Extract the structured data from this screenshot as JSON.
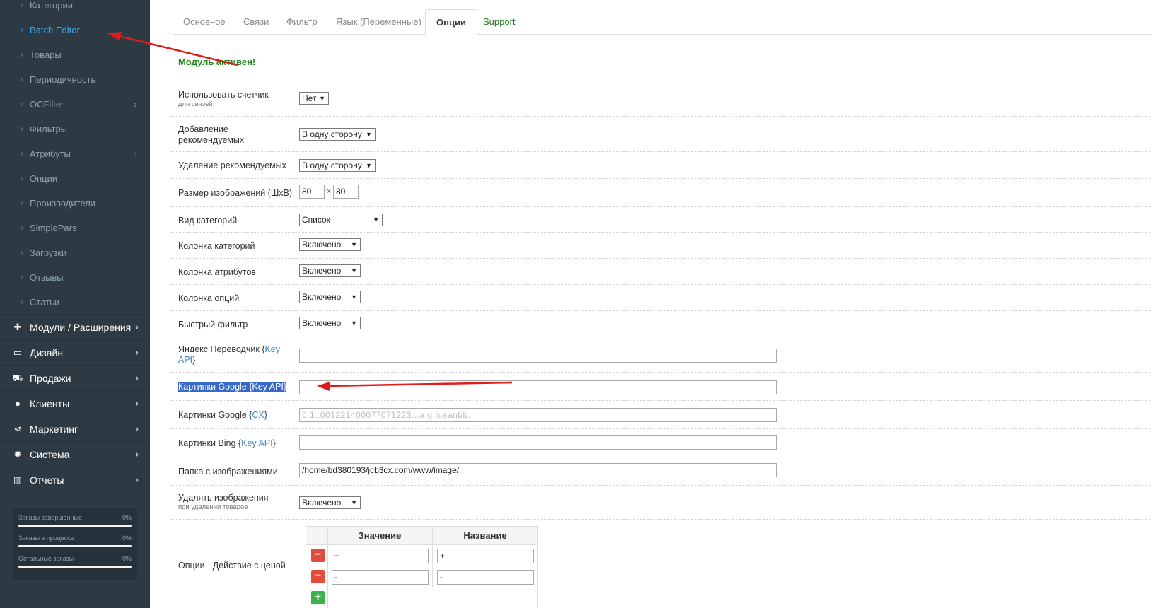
{
  "sidebar": {
    "sub_items": [
      {
        "label": "Категории",
        "has_arrow": false,
        "active": false
      },
      {
        "label": "Batch Editor",
        "has_arrow": false,
        "active": true
      },
      {
        "label": "Товары",
        "has_arrow": false,
        "active": false
      },
      {
        "label": "Периодичность",
        "has_arrow": false,
        "active": false
      },
      {
        "label": "OCFilter",
        "has_arrow": true,
        "active": false
      },
      {
        "label": "Фильтры",
        "has_arrow": false,
        "active": false
      },
      {
        "label": "Атрибуты",
        "has_arrow": true,
        "active": false
      },
      {
        "label": "Опции",
        "has_arrow": false,
        "active": false
      },
      {
        "label": "Производители",
        "has_arrow": false,
        "active": false
      },
      {
        "label": "SimplePars",
        "has_arrow": false,
        "active": false
      },
      {
        "label": "Загрузки",
        "has_arrow": false,
        "active": false
      },
      {
        "label": "Отзывы",
        "has_arrow": false,
        "active": false
      },
      {
        "label": "Статьи",
        "has_arrow": false,
        "active": false
      }
    ],
    "main_items": [
      {
        "label": "Модули / Расширения",
        "icon": "puzzle-icon"
      },
      {
        "label": "Дизайн",
        "icon": "monitor-icon"
      },
      {
        "label": "Продажи",
        "icon": "cart-icon"
      },
      {
        "label": "Клиенты",
        "icon": "user-icon"
      },
      {
        "label": "Маркетинг",
        "icon": "share-icon"
      },
      {
        "label": "Система",
        "icon": "gear-icon"
      },
      {
        "label": "Отчеты",
        "icon": "bar-chart-icon"
      }
    ],
    "stats": [
      {
        "label": "Заказы завершенные",
        "value": "0%",
        "progress": 0
      },
      {
        "label": "Заказы в процессе",
        "value": "0%",
        "progress": 0
      },
      {
        "label": "Остальные заказы",
        "value": "0%",
        "progress": 0
      }
    ]
  },
  "tabs": [
    "Основное",
    "Связи",
    "Фильтр",
    "Язык (Переменные)",
    "Опции",
    "Support"
  ],
  "active_tab": "Опции",
  "status": "Модуль активен!",
  "form": {
    "counter": {
      "label": "Использовать счетчик",
      "hint": "для связей",
      "value": "Нет"
    },
    "add_recommended": {
      "label": "Добавление рекомендуемых",
      "value": "В одну сторону"
    },
    "remove_recommended": {
      "label": "Удаление рекомендуемых",
      "value": "В одну сторону"
    },
    "image_size": {
      "label": "Размер изображений (ШхВ)",
      "width": "80",
      "height": "80",
      "sep": "×"
    },
    "category_view": {
      "label": "Вид категорий",
      "value": "Список"
    },
    "category_column": {
      "label": "Колонка категорий",
      "value": "Включено"
    },
    "attribute_column": {
      "label": "Колонка атрибутов",
      "value": "Включено"
    },
    "option_column": {
      "label": "Колонка опций",
      "value": "Включено"
    },
    "quick_filter": {
      "label": "Быстрый фильтр",
      "value": "Включено"
    },
    "yandex": {
      "label_prefix": "Яндекс Переводчик {",
      "link": "Key API",
      "label_suffix": "}",
      "value": ""
    },
    "google_key": {
      "label_prefix": "Картинки Google {",
      "link": "Key API",
      "label_suffix": "}",
      "value": ""
    },
    "google_cx": {
      "label_prefix": "Картинки Google {",
      "link": "CX",
      "label_suffix": "}",
      "value": "0.1..001221400077071223...a.g.h.sanbb."
    },
    "bing_key": {
      "label_prefix": "Картинки Bing {",
      "link": "Key API",
      "label_suffix": "}",
      "value": ""
    },
    "image_folder": {
      "label": "Папка с изображениями",
      "value": "/home/bd380193/jcb3cx.com/www/image/"
    },
    "delete_images": {
      "label": "Удалять изображения",
      "hint": "при удалении товаров",
      "value": "Включено"
    },
    "price_options": {
      "label": "Опции - Действие с ценой",
      "col_value": "Значение",
      "col_name": "Название",
      "rows": [
        {
          "value": "+",
          "name": "+"
        },
        {
          "value": "-",
          "name": "-"
        }
      ]
    }
  },
  "colors": {
    "sidebar_bg": "#2d3a44",
    "accent": "#3eaae5",
    "status_green": "#1e8a1e",
    "arrow_red": "#e01b1b"
  }
}
